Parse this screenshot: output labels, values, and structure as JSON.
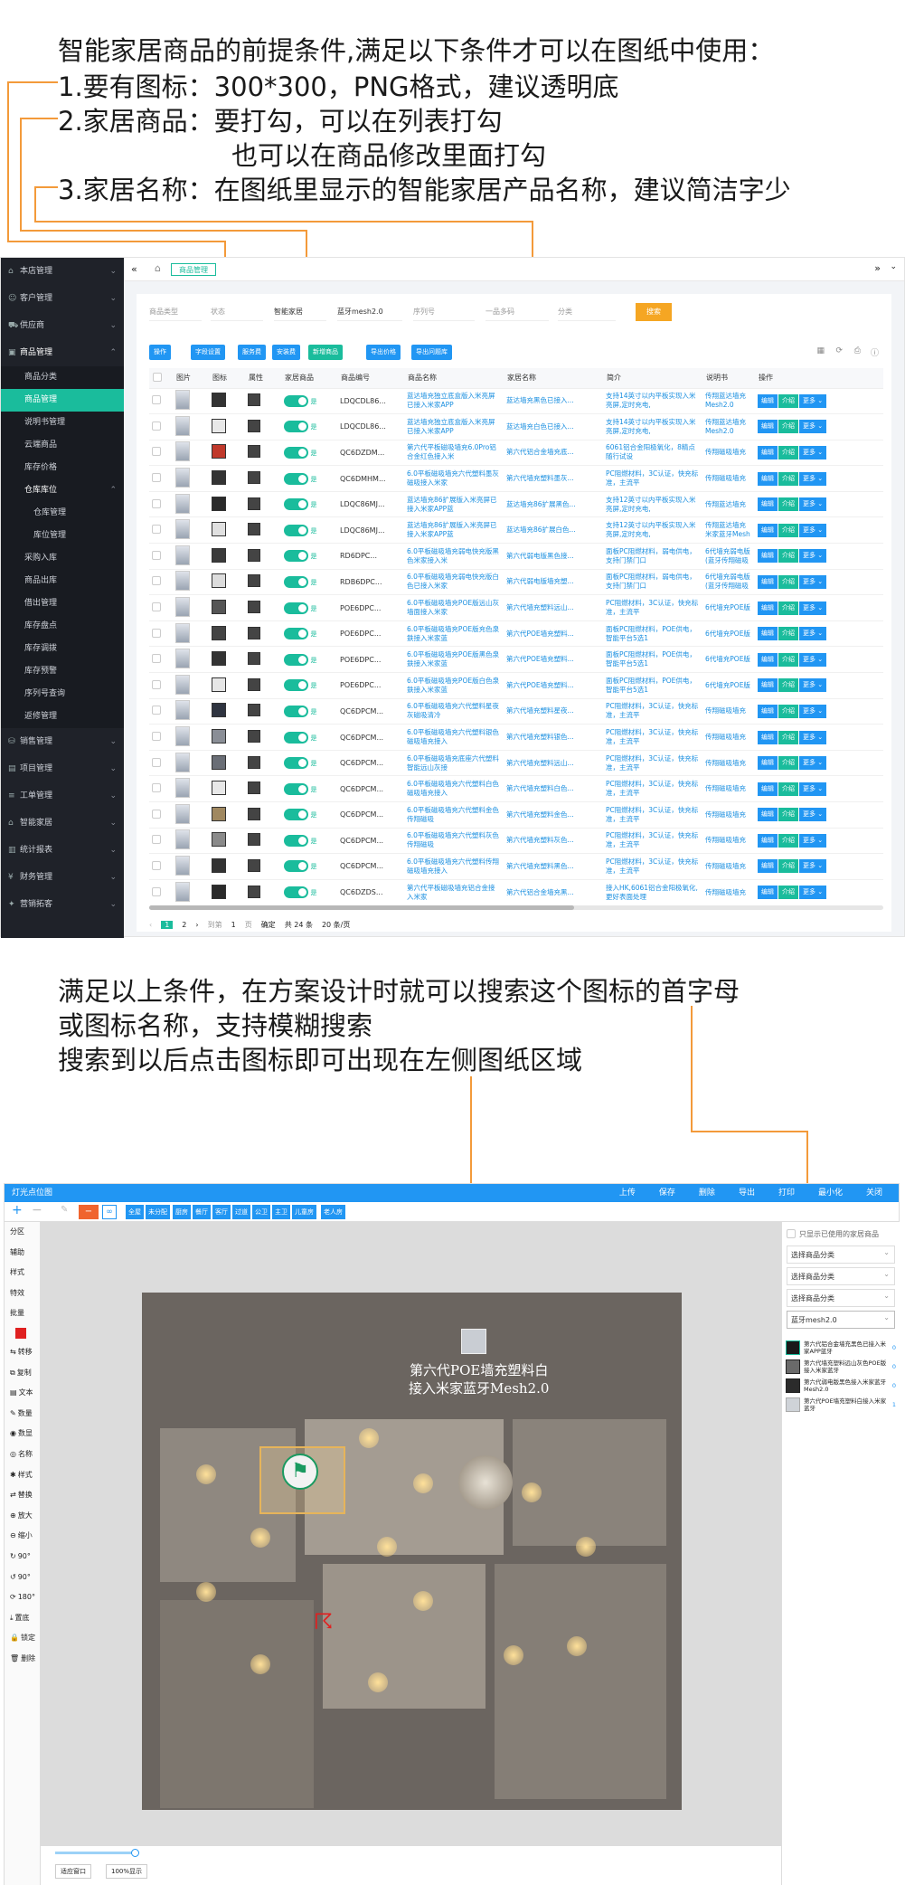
{
  "intro": {
    "line1": "智能家居商品的前提条件,满足以下条件才可以在图纸中使用：",
    "line2": "1.要有图标：300*300，PNG格式，建议透明底",
    "line3": "2.家居商品：要打勾，可以在列表打勾",
    "line4": "也可以在商品修改里面打勾",
    "line5": "3.家居名称：在图纸里显示的智能家居产品名称，建议简洁字少"
  },
  "mid": {
    "line1": "满足以上条件，在方案设计时就可以搜索这个图标的首字母",
    "line2": "或图标名称，支持模糊搜索",
    "line3": "搜索到以后点击图标即可出现在左侧图纸区域"
  },
  "sidebar": {
    "items": [
      {
        "label": "本店管理"
      },
      {
        "label": "客户管理"
      },
      {
        "label": "供应商"
      },
      {
        "label": "商品管理"
      }
    ],
    "subs": [
      "商品分类",
      "商品管理",
      "说明书管理",
      "云端商品",
      "库存价格"
    ],
    "warehouse": "仓库库位",
    "wsubs": [
      "仓库管理",
      "库位管理"
    ],
    "subs2": [
      "采购入库",
      "商品出库",
      "借出管理",
      "库存盘点",
      "库存调拨",
      "库存预警",
      "序列号查询",
      "返修管理"
    ],
    "items2": [
      {
        "label": "销售管理"
      },
      {
        "label": "项目管理"
      },
      {
        "label": "工单管理"
      },
      {
        "label": "智能家居"
      },
      {
        "label": "统计报表"
      },
      {
        "label": "财务管理"
      },
      {
        "label": "营销拓客"
      }
    ]
  },
  "topbar": {
    "tab": "商品管理"
  },
  "filters": {
    "type": "商品类型",
    "status": "状态",
    "smart": "智能家居",
    "keyword": "蓝牙mesh2.0",
    "serial": "序列号",
    "barcode": "一品多码",
    "category": "分类",
    "search": "搜索"
  },
  "actions": [
    "操作",
    "字段设置",
    "服务费",
    "安装费",
    "新增商品",
    "导出价格",
    "导出问题库"
  ],
  "table": {
    "headers": [
      "图片",
      "图标",
      "属性",
      "家居商品",
      "商品编号",
      "商品名称",
      "家居名称",
      "简介",
      "说明书",
      "操作"
    ],
    "rows": [
      {
        "code": "LDQCDL86...",
        "name": "蓝达墙充独立底盒版入米亮屏已接入米家APP",
        "home": "蓝达墙充黑色已接入...",
        "intro": "支持14英寸以内平板实现入米亮屏,定时充电,",
        "manual": "传翔蓝达墙充Mesh2.0"
      },
      {
        "code": "LDQCDL86...",
        "name": "蓝达墙充独立底盒版入米亮屏已接入米家APP",
        "home": "蓝达墙充白色已接入...",
        "intro": "支持14英寸以内平板实现入米亮屏,定时充电,",
        "manual": "传翔蓝达墙充Mesh2.0"
      },
      {
        "code": "QC6DZDM...",
        "name": "第六代平板磁吸墙充6.0Pro铝合金红色接入米",
        "home": "第六代铝合金墙充底...",
        "intro": "6061铝合金阳极氧化，8精点随行试设",
        "manual": "传翔磁吸墙充"
      },
      {
        "code": "QC6DMHM...",
        "name": "6.0平板磁吸墙充六代塑料墨灰磁吸接入米家",
        "home": "第六代墙充塑料墨灰...",
        "intro": "PC阻燃材料，3C认证，快充标准，主流平",
        "manual": "传翔磁吸墙充"
      },
      {
        "code": "LDQC86MJ...",
        "name": "蓝达墙充86扩展版入米亮屏已接入米家APP蓝",
        "home": "蓝达墙充86扩展黑色...",
        "intro": "支持12英寸以内平板实现入米亮屏,定时充电,",
        "manual": "传翔蓝达墙充"
      },
      {
        "code": "LDQC86MJ...",
        "name": "蓝达墙充86扩展版入米亮屏已接入米家APP蓝",
        "home": "蓝达墙充86扩展白色...",
        "intro": "支持12英寸以内平板实现入米亮屏,定时充电,",
        "manual": "传翔蓝达墙充米家蓝牙Mesh"
      },
      {
        "code": "RD6DPC...",
        "name": "6.0平板磁吸墙充弱电快充版黑色米家接入米",
        "home": "第六代弱电版黑色接...",
        "intro": "面板PC阻燃材料，弱电供电，支持门禁门口",
        "manual": "6代墙充弱电版(蓝牙传翔磁吸"
      },
      {
        "code": "RDB6DPC...",
        "name": "6.0平板磁吸墙充弱电快充版白色已接入米家",
        "home": "第六代弱电版墙充塑...",
        "intro": "面板PC阻燃材料，弱电供电，支持门禁门口",
        "manual": "6代墙充弱电版(蓝牙传翔磁吸"
      },
      {
        "code": "POE6DPC...",
        "name": "6.0平板磁吸墙充POE版远山灰墙面接入米家",
        "home": "第六代墙充塑料远山...",
        "intro": "PC阻燃材料，3C认证，快充标准，主流平",
        "manual": "6代墙充POE版"
      },
      {
        "code": "POE6DPC...",
        "name": "6.0平板磁吸墙充POE版充色泉鉄接入米家蓝",
        "home": "第六代POE墙充塑料...",
        "intro": "面板PC阻燃材料，POE供电，智能平台5选1",
        "manual": "6代墙充POE版"
      },
      {
        "code": "POE6DPC...",
        "name": "6.0平板磁吸墙充POE版黑色泉鉄接入米家蓝",
        "home": "第六代POE墙充塑料...",
        "intro": "面板PC阻燃材料，POE供电，智能平台5选1",
        "manual": "6代墙充POE版"
      },
      {
        "code": "POE6DPC...",
        "name": "6.0平板磁吸墙充POE版白色泉鉄接入米家蓝",
        "home": "第六代POE墙充塑料...",
        "intro": "面板PC阻燃材料，POE供电，智能平台5选1",
        "manual": "6代墙充POE版"
      },
      {
        "code": "QC6DPCM...",
        "name": "6.0平板磁吸墙充六代塑料星夜灰磁吸清冷",
        "home": "第六代墙充塑料星夜...",
        "intro": "PC阻燃材料，3C认证，快充标准，主流平",
        "manual": "传翔磁吸墙充"
      },
      {
        "code": "QC6DPCM...",
        "name": "6.0平板磁吸墙充六代塑料银色磁吸墙充接入",
        "home": "第六代墙充塑料银色...",
        "intro": "PC阻燃材料，3C认证，快充标准，主流平",
        "manual": "传翔磁吸墙充"
      },
      {
        "code": "QC6DPCM...",
        "name": "6.0平板磁吸墙充底座六代塑料智能远山灰接",
        "home": "第六代墙充塑料远山...",
        "intro": "PC阻燃材料，3C认证，快充标准，主流平",
        "manual": "传翔磁吸墙充"
      },
      {
        "code": "QC6DPCM...",
        "name": "6.0平板磁吸墙充六代塑料白色磁吸墙充接入",
        "home": "第六代墙充塑料白色...",
        "intro": "PC阻燃材料，3C认证，快充标准，主流平",
        "manual": "传翔磁吸墙充"
      },
      {
        "code": "QC6DPCM...",
        "name": "6.0平板磁吸墙充六代塑料金色传翔磁吸",
        "home": "第六代墙充塑料金色...",
        "intro": "PC阻燃材料，3C认证，快充标准，主流平",
        "manual": "传翔磁吸墙充"
      },
      {
        "code": "QC6DPCM...",
        "name": "6.0平板磁吸墙充六代塑料灰色传翔磁吸",
        "home": "第六代墙充塑料灰色...",
        "intro": "PC阻燃材料，3C认证，快充标准，主流平",
        "manual": "传翔磁吸墙充"
      },
      {
        "code": "QC6DPCM...",
        "name": "6.0平板磁吸墙充六代塑料传翔磁吸墙充接入",
        "home": "第六代墙充塑料黑色...",
        "intro": "PC阻燃材料，3C认证，快充标准，主流平",
        "manual": "传翔磁吸墙充"
      },
      {
        "code": "QC6DZDS...",
        "name": "第六代平板磁吸墙充铝合金接入米家",
        "home": "第六代铝合金墙充黑...",
        "intro": "接入HK,6061铝合金阳极氧化,更好表面处理",
        "manual": "传翔磁吸墙充"
      }
    ],
    "ops": [
      "编辑",
      "介绍",
      "更多"
    ],
    "flag": "是"
  },
  "pagination": {
    "p1": "1",
    "p2": "2",
    "jump": "到第",
    "page": "1",
    "unit": "页",
    "confirm": "确定",
    "total": "共 24 条",
    "per": "20 条/页"
  },
  "p2": {
    "title": "灯光点位图",
    "top_actions": [
      "上传",
      "保存",
      "删除",
      "导出",
      "打印",
      "最小化",
      "关闭"
    ],
    "tabs": [
      "全屋",
      "未分配",
      "厨房",
      "餐厅",
      "客厅",
      "过道",
      "公卫",
      "主卫",
      "儿童房",
      "老人房"
    ],
    "left": [
      "分区",
      "辅助",
      "样式",
      "特效",
      "批量",
      "转移",
      "复制",
      "文本",
      "数量",
      "数显",
      "名称",
      "样式",
      "替换",
      "放大",
      "缩小",
      "90°",
      "90°",
      "180°",
      "置底",
      "锁定",
      "删除"
    ],
    "canvas_label1": "第六代POE墙充塑料白",
    "canvas_label2": "接入米家蓝牙Mesh2.0",
    "only_used": "只显示已使用的家居商品",
    "selects": [
      "选择商品分类",
      "选择商品分类",
      "选择商品分类"
    ],
    "search": "蓝牙mesh2.0",
    "results": [
      {
        "name": "第六代铝合金墙充黑色已接入米家APP蓝牙",
        "n": "0"
      },
      {
        "name": "第六代墙充塑料远山灰色POE版接入米家蓝牙",
        "n": "0"
      },
      {
        "name": "第六代弱电版黑色接入米家蓝牙Mesh2.0",
        "n": "0"
      },
      {
        "name": "第六代POE墙充塑料白接入米家蓝牙",
        "n": "1"
      }
    ],
    "bottom": [
      "适应窗口",
      "100%显示"
    ]
  }
}
